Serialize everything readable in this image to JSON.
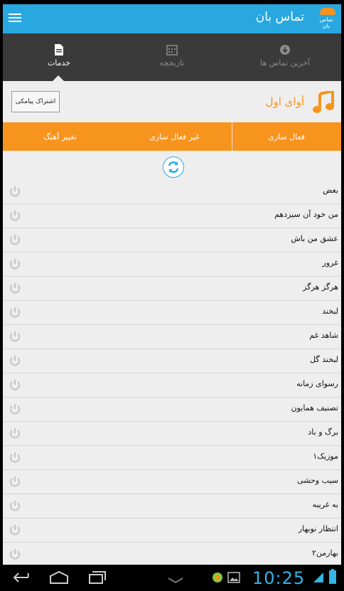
{
  "app": {
    "title": "تماس بان",
    "logo_text": "تماس بان"
  },
  "tabs": [
    {
      "label": "خدمات",
      "icon": "document-icon",
      "active": true
    },
    {
      "label": "تاریخچه",
      "icon": "calendar-icon",
      "active": false
    },
    {
      "label": "آخرین تماس ها",
      "icon": "download-icon",
      "active": false
    }
  ],
  "section": {
    "title": "آوای اول",
    "subscribe_label": "اشتراک پیامکی"
  },
  "actions": {
    "change_tone": "تغییر آهنگ",
    "deactivate": "غیر فعال سازی",
    "activate": "فعال سازی"
  },
  "songs": [
    "بغض",
    "من خود آن سیزدهم",
    "عشق من باش",
    "غرور",
    "هرگز هرگز",
    "لبخند",
    "شاهد غم",
    "لبخند گل",
    "رسوای زمانه",
    "تصنیف همایون",
    "برگ و باد",
    "موزیک۱",
    "سیب وحشی",
    "به غریبه",
    "انتظار نوبهار",
    "بهارمن۲"
  ],
  "status": {
    "time": "10:25"
  },
  "colors": {
    "accent_blue": "#29a8e0",
    "accent_orange": "#f7941d",
    "tab_bar": "#3a3a3a"
  }
}
